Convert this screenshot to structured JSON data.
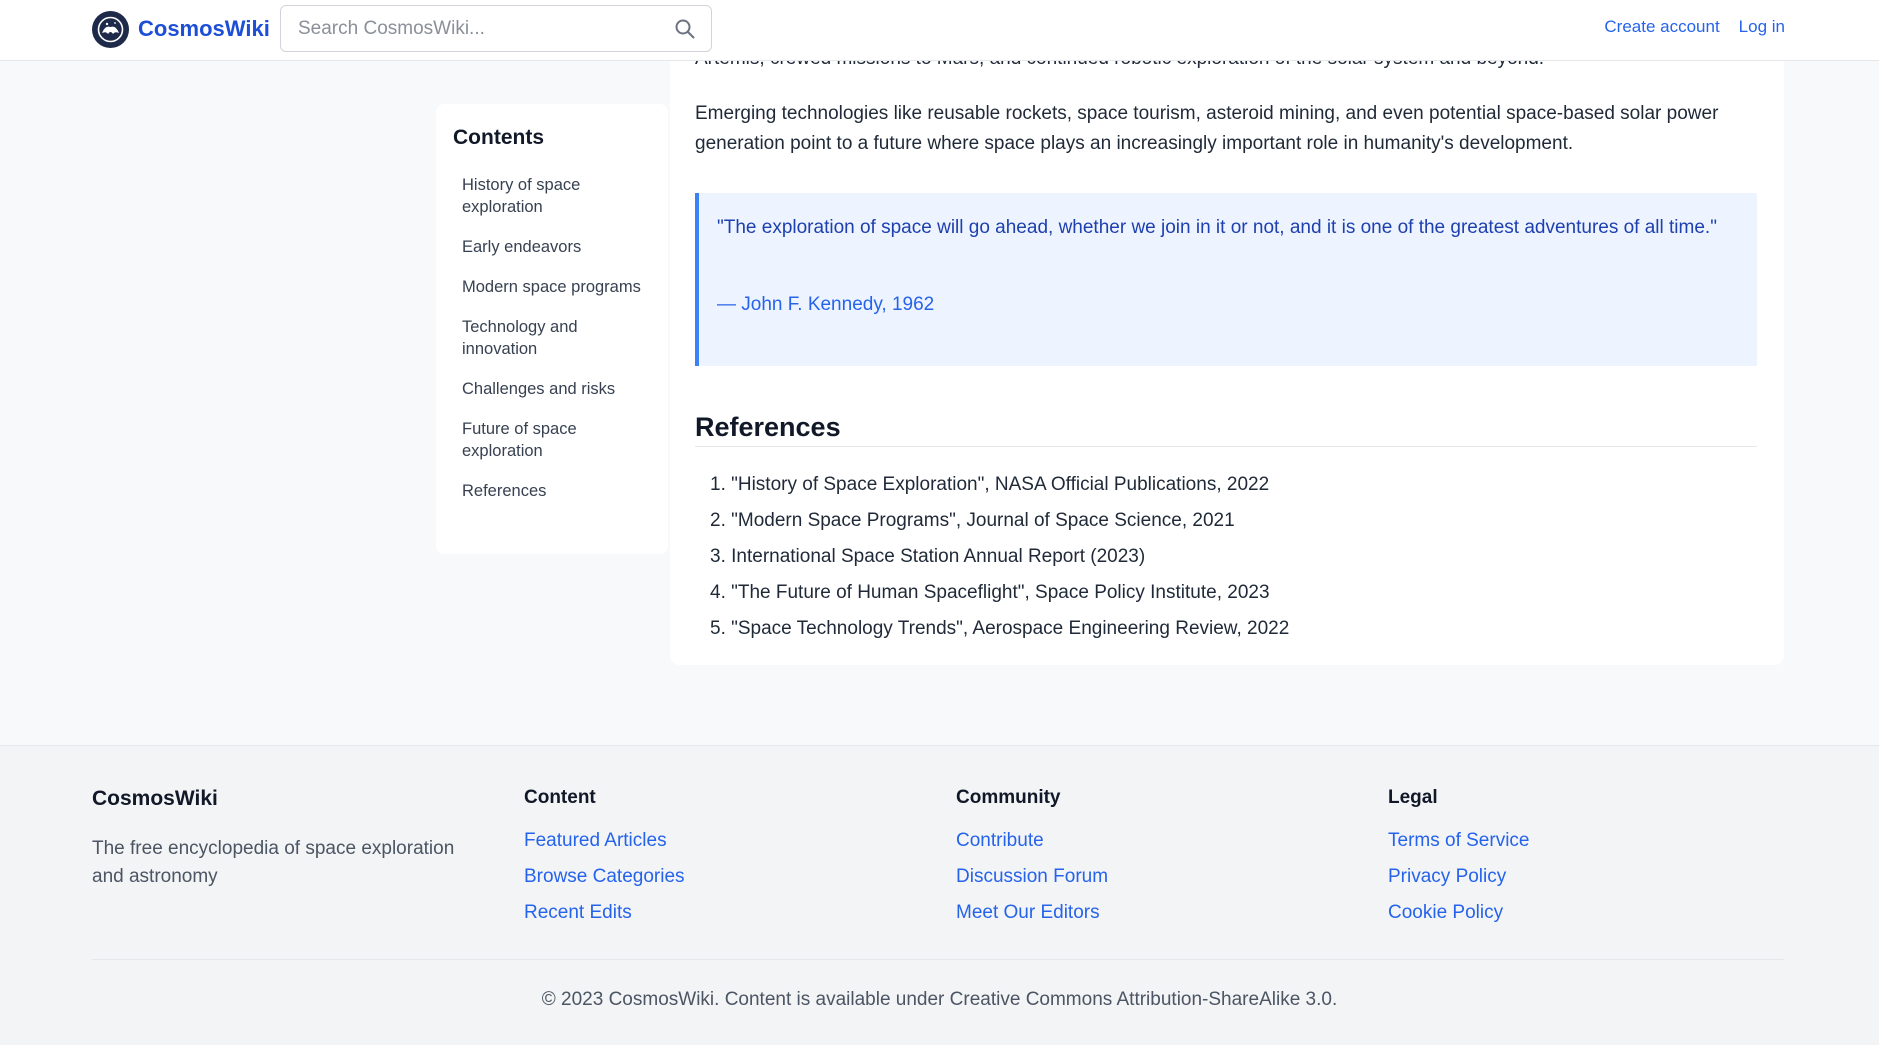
{
  "header": {
    "brand": "CosmosWiki",
    "search_placeholder": "Search CosmosWiki...",
    "create_account": "Create account",
    "log_in": "Log in"
  },
  "toc": {
    "title": "Contents",
    "items": [
      "History of space exploration",
      "Early endeavors",
      "Modern space programs",
      "Technology and innovation",
      "Challenges and risks",
      "Future of space exploration",
      "References"
    ]
  },
  "article": {
    "clipped_line": "Artemis, crewed missions to Mars, and continued robotic exploration of the solar system and beyond.",
    "paragraph": "Emerging technologies like reusable rockets, space tourism, asteroid mining, and even potential space-based solar power generation point to a future where space plays an increasingly important role in humanity's development.",
    "quote": "\"The exploration of space will go ahead, whether we join in it or not, and it is one of the greatest adventures of all time.\"",
    "quote_cite": "— John F. Kennedy, 1962",
    "references_title": "References",
    "references": [
      "1. \"History of Space Exploration\", NASA Official Publications, 2022",
      "2. \"Modern Space Programs\", Journal of Space Science, 2021",
      "3. International Space Station Annual Report (2023)",
      "4. \"The Future of Human Spaceflight\", Space Policy Institute, 2023",
      "5. \"Space Technology Trends\", Aerospace Engineering Review, 2022"
    ]
  },
  "footer": {
    "brand": "CosmosWiki",
    "description": "The free encyclopedia of space exploration and astronomy",
    "columns": [
      {
        "heading": "Content",
        "links": [
          "Featured Articles",
          "Browse Categories",
          "Recent Edits"
        ]
      },
      {
        "heading": "Community",
        "links": [
          "Contribute",
          "Discussion Forum",
          "Meet Our Editors"
        ]
      },
      {
        "heading": "Legal",
        "links": [
          "Terms of Service",
          "Privacy Policy",
          "Cookie Policy"
        ]
      }
    ],
    "copyright": "© 2023 CosmosWiki. Content is available under Creative Commons Attribution-ShareAlike 3.0."
  },
  "colors": {
    "accent": "#2563eb",
    "quote_bg": "#eef4ff",
    "quote_border": "#3b82f6"
  },
  "icons": {
    "logo": "cosmos-logo-icon",
    "search": "search-icon"
  }
}
